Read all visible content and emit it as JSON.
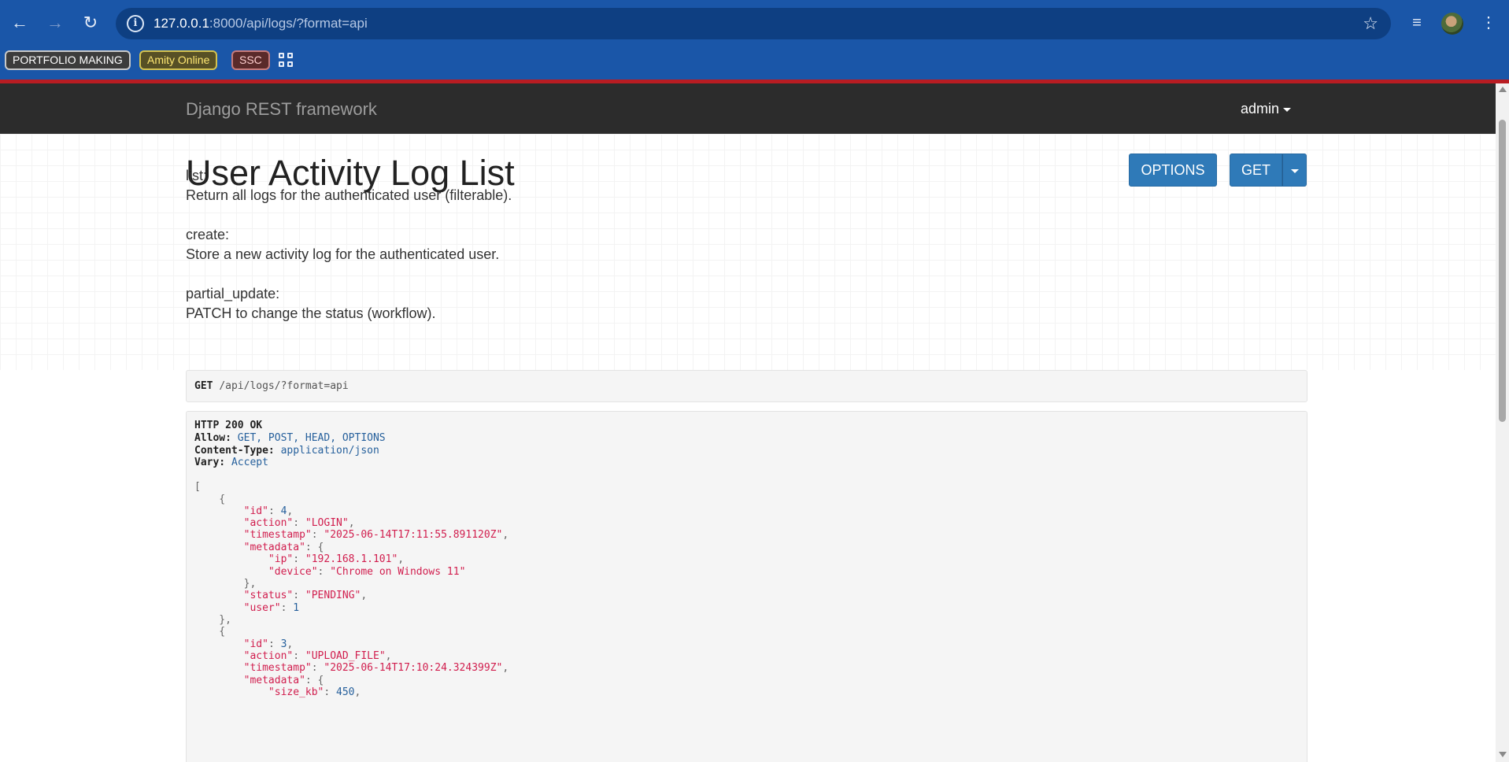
{
  "browser": {
    "url_host": "127.0.0.1",
    "url_rest": ":8000/api/logs/?format=api",
    "icons": [
      "back-icon",
      "forward-icon",
      "reload-icon",
      "site-info-icon",
      "star-icon",
      "media-icon",
      "avatar",
      "menu-icon"
    ],
    "bookmarks": [
      "PORTFOLIO MAKING",
      "Amity Online",
      "SSC"
    ]
  },
  "navbar": {
    "brand": "Django REST framework",
    "user": "admin"
  },
  "main": {
    "title": "User Activity Log List",
    "options_label": "OPTIONS",
    "get_label": "GET",
    "description": [
      "list:",
      "Return all logs for the authenticated user (filterable).",
      "create:",
      "Store a new activity log for the authenticated user.",
      "partial_update:",
      "PATCH to change the status (workflow)."
    ]
  },
  "request": {
    "method": "GET",
    "path": "/api/logs/?format=api"
  },
  "response": {
    "status": "HTTP 200 OK",
    "headers": [
      {
        "key": "Allow:",
        "value": "GET, POST, HEAD, OPTIONS"
      },
      {
        "key": "Content-Type:",
        "value": "application/json"
      },
      {
        "key": "Vary:",
        "value": "Accept"
      }
    ],
    "logs": [
      {
        "id": "4",
        "action": "\"LOGIN\"",
        "timestamp": "\"2025-06-14T17:11:55.891120Z\"",
        "ip": "\"192.168.1.101\"",
        "device": "\"Chrome on Windows 11\"",
        "status": "\"PENDING\"",
        "user": "1"
      },
      {
        "id": "3",
        "action": "\"UPLOAD_FILE\"",
        "timestamp": "\"2025-06-14T17:10:24.324399Z\"",
        "size_kb": "450"
      }
    ]
  },
  "colors": {
    "chrome": "#1a56a8",
    "navbar": "#2c2c2c",
    "button": "#2f7ab8",
    "json_string": "#d11e4e",
    "json_number": "#26609c"
  }
}
